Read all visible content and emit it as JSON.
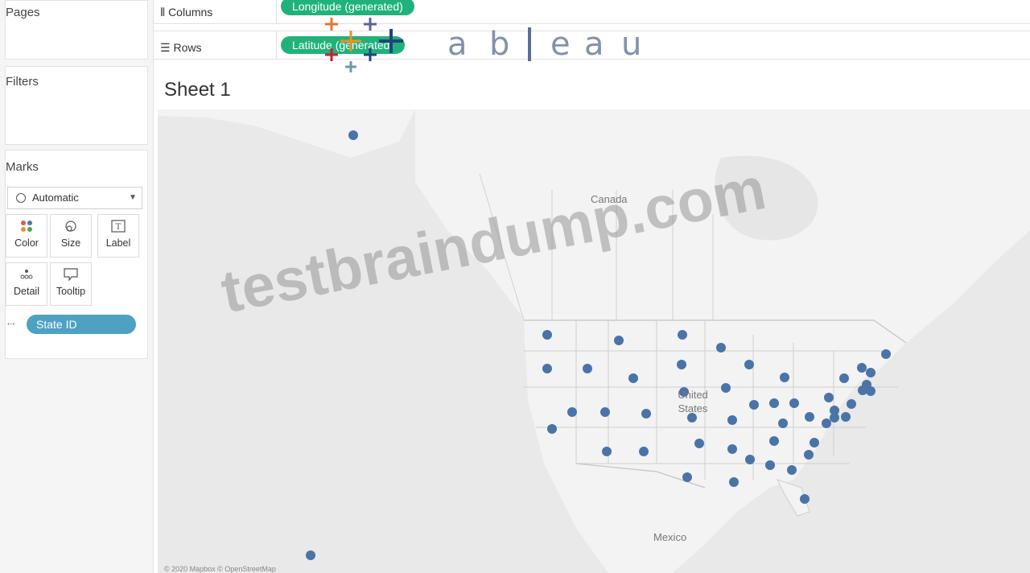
{
  "pages": {
    "title": "Pages"
  },
  "filters": {
    "title": "Filters"
  },
  "marks": {
    "title": "Marks",
    "mark_type": "Automatic",
    "buttons": [
      "Color",
      "Size",
      "Label",
      "Detail",
      "Tooltip"
    ],
    "detail_pill": "State ID"
  },
  "shelves": {
    "columns_label": "Columns",
    "columns_pill": "Longitude (generated)",
    "rows_label": "Rows",
    "rows_pill": "Latitude (generated)"
  },
  "logo": {
    "text": "+ a b | e a u"
  },
  "sheet": {
    "title": "Sheet 1"
  },
  "map": {
    "labels": {
      "canada": "Canada",
      "us": "United States",
      "mexico": "Mexico"
    },
    "copyright": "© 2020 Mapbox © OpenStreetMap"
  },
  "watermark": "testbraindump.com",
  "colors": {
    "accent_green": "#20b27a",
    "pill_blue": "#4ea1c3",
    "dot": "#4a73a8"
  }
}
